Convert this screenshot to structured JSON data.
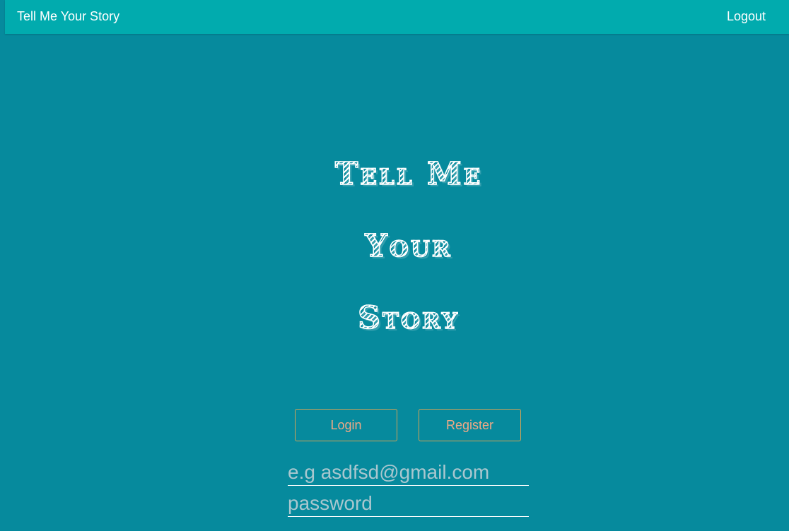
{
  "navbar": {
    "brand": "Tell Me Your Story",
    "logout": "Logout"
  },
  "hero": {
    "line1": "Tell Me",
    "line2": "Your",
    "line3": "Story"
  },
  "auth": {
    "login_label": "Login",
    "register_label": "Register",
    "email_placeholder": "e.g asdfsd@gmail.com",
    "password_placeholder": "password"
  },
  "colors": {
    "background": "#068a9d",
    "navbar": "#01abae",
    "button_border": "#d2a356",
    "button_text": "#f0a986"
  }
}
